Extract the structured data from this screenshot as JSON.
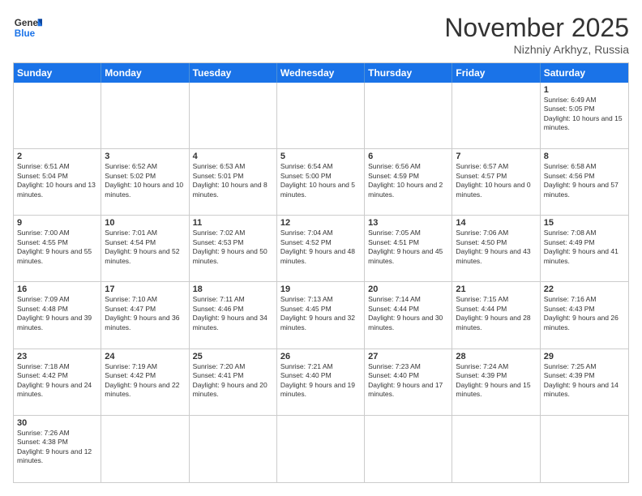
{
  "logo": {
    "text_general": "General",
    "text_blue": "Blue"
  },
  "header": {
    "month_year": "November 2025",
    "location": "Nizhniy Arkhyz, Russia"
  },
  "day_headers": [
    "Sunday",
    "Monday",
    "Tuesday",
    "Wednesday",
    "Thursday",
    "Friday",
    "Saturday"
  ],
  "weeks": [
    [
      {
        "day": "",
        "info": ""
      },
      {
        "day": "",
        "info": ""
      },
      {
        "day": "",
        "info": ""
      },
      {
        "day": "",
        "info": ""
      },
      {
        "day": "",
        "info": ""
      },
      {
        "day": "",
        "info": ""
      },
      {
        "day": "1",
        "info": "Sunrise: 6:49 AM\nSunset: 5:05 PM\nDaylight: 10 hours and 15 minutes."
      }
    ],
    [
      {
        "day": "2",
        "info": "Sunrise: 6:51 AM\nSunset: 5:04 PM\nDaylight: 10 hours and 13 minutes."
      },
      {
        "day": "3",
        "info": "Sunrise: 6:52 AM\nSunset: 5:02 PM\nDaylight: 10 hours and 10 minutes."
      },
      {
        "day": "4",
        "info": "Sunrise: 6:53 AM\nSunset: 5:01 PM\nDaylight: 10 hours and 8 minutes."
      },
      {
        "day": "5",
        "info": "Sunrise: 6:54 AM\nSunset: 5:00 PM\nDaylight: 10 hours and 5 minutes."
      },
      {
        "day": "6",
        "info": "Sunrise: 6:56 AM\nSunset: 4:59 PM\nDaylight: 10 hours and 2 minutes."
      },
      {
        "day": "7",
        "info": "Sunrise: 6:57 AM\nSunset: 4:57 PM\nDaylight: 10 hours and 0 minutes."
      },
      {
        "day": "8",
        "info": "Sunrise: 6:58 AM\nSunset: 4:56 PM\nDaylight: 9 hours and 57 minutes."
      }
    ],
    [
      {
        "day": "9",
        "info": "Sunrise: 7:00 AM\nSunset: 4:55 PM\nDaylight: 9 hours and 55 minutes."
      },
      {
        "day": "10",
        "info": "Sunrise: 7:01 AM\nSunset: 4:54 PM\nDaylight: 9 hours and 52 minutes."
      },
      {
        "day": "11",
        "info": "Sunrise: 7:02 AM\nSunset: 4:53 PM\nDaylight: 9 hours and 50 minutes."
      },
      {
        "day": "12",
        "info": "Sunrise: 7:04 AM\nSunset: 4:52 PM\nDaylight: 9 hours and 48 minutes."
      },
      {
        "day": "13",
        "info": "Sunrise: 7:05 AM\nSunset: 4:51 PM\nDaylight: 9 hours and 45 minutes."
      },
      {
        "day": "14",
        "info": "Sunrise: 7:06 AM\nSunset: 4:50 PM\nDaylight: 9 hours and 43 minutes."
      },
      {
        "day": "15",
        "info": "Sunrise: 7:08 AM\nSunset: 4:49 PM\nDaylight: 9 hours and 41 minutes."
      }
    ],
    [
      {
        "day": "16",
        "info": "Sunrise: 7:09 AM\nSunset: 4:48 PM\nDaylight: 9 hours and 39 minutes."
      },
      {
        "day": "17",
        "info": "Sunrise: 7:10 AM\nSunset: 4:47 PM\nDaylight: 9 hours and 36 minutes."
      },
      {
        "day": "18",
        "info": "Sunrise: 7:11 AM\nSunset: 4:46 PM\nDaylight: 9 hours and 34 minutes."
      },
      {
        "day": "19",
        "info": "Sunrise: 7:13 AM\nSunset: 4:45 PM\nDaylight: 9 hours and 32 minutes."
      },
      {
        "day": "20",
        "info": "Sunrise: 7:14 AM\nSunset: 4:44 PM\nDaylight: 9 hours and 30 minutes."
      },
      {
        "day": "21",
        "info": "Sunrise: 7:15 AM\nSunset: 4:44 PM\nDaylight: 9 hours and 28 minutes."
      },
      {
        "day": "22",
        "info": "Sunrise: 7:16 AM\nSunset: 4:43 PM\nDaylight: 9 hours and 26 minutes."
      }
    ],
    [
      {
        "day": "23",
        "info": "Sunrise: 7:18 AM\nSunset: 4:42 PM\nDaylight: 9 hours and 24 minutes."
      },
      {
        "day": "24",
        "info": "Sunrise: 7:19 AM\nSunset: 4:42 PM\nDaylight: 9 hours and 22 minutes."
      },
      {
        "day": "25",
        "info": "Sunrise: 7:20 AM\nSunset: 4:41 PM\nDaylight: 9 hours and 20 minutes."
      },
      {
        "day": "26",
        "info": "Sunrise: 7:21 AM\nSunset: 4:40 PM\nDaylight: 9 hours and 19 minutes."
      },
      {
        "day": "27",
        "info": "Sunrise: 7:23 AM\nSunset: 4:40 PM\nDaylight: 9 hours and 17 minutes."
      },
      {
        "day": "28",
        "info": "Sunrise: 7:24 AM\nSunset: 4:39 PM\nDaylight: 9 hours and 15 minutes."
      },
      {
        "day": "29",
        "info": "Sunrise: 7:25 AM\nSunset: 4:39 PM\nDaylight: 9 hours and 14 minutes."
      }
    ],
    [
      {
        "day": "30",
        "info": "Sunrise: 7:26 AM\nSunset: 4:38 PM\nDaylight: 9 hours and 12 minutes."
      },
      {
        "day": "",
        "info": ""
      },
      {
        "day": "",
        "info": ""
      },
      {
        "day": "",
        "info": ""
      },
      {
        "day": "",
        "info": ""
      },
      {
        "day": "",
        "info": ""
      },
      {
        "day": "",
        "info": ""
      }
    ]
  ]
}
